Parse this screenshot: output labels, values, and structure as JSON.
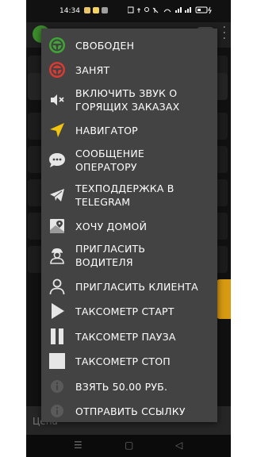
{
  "statusbar": {
    "time": "14:34"
  },
  "background": {
    "price_label": "Цена"
  },
  "colors": {
    "menu_bg": "#434343",
    "green": "#3fa535",
    "red": "#d93a32",
    "yellow": "#f1c40f",
    "icon_light": "#e6e6e6"
  },
  "menu": {
    "items": [
      {
        "label": "СВОБОДЕН",
        "icon": "steering-wheel-green-icon"
      },
      {
        "label": "ЗАНЯТ",
        "icon": "steering-wheel-red-icon"
      },
      {
        "label_1": "ВКЛЮЧИТЬ ЗВУК О",
        "label_2": "ГОРЯЩИХ ЗАКАЗАХ",
        "icon": "sound-muted-icon"
      },
      {
        "label": "НАВИГАТОР",
        "icon": "navigation-arrow-icon"
      },
      {
        "label_1": "СООБЩЕНИЕ",
        "label_2": "ОПЕРАТОРУ",
        "icon": "chat-bubble-icon"
      },
      {
        "label_1": "ТЕХПОДДЕРЖКА В",
        "label_2": "TELEGRAM",
        "icon": "telegram-icon"
      },
      {
        "label": "ХОЧУ ДОМОЙ",
        "icon": "map-pin-icon"
      },
      {
        "label_1": "ПРИГЛАСИТЬ",
        "label_2": "ВОДИТЕЛЯ",
        "icon": "driver-icon"
      },
      {
        "label": "ПРИГЛАСИТЬ КЛИЕНТА",
        "icon": "person-icon"
      },
      {
        "label": "ТАКСОМЕТР СТАРТ",
        "icon": "play-icon"
      },
      {
        "label": "ТАКСОМЕТР ПАУЗА",
        "icon": "pause-icon"
      },
      {
        "label": "ТАКСОМЕТР СТОП",
        "icon": "stop-icon"
      },
      {
        "label": "ВЗЯТЬ 50.00 РУБ.",
        "icon": "info-dot-icon"
      },
      {
        "label": "ОТПРАВИТЬ ССЫЛКУ",
        "icon": "info-dot-icon"
      }
    ]
  }
}
